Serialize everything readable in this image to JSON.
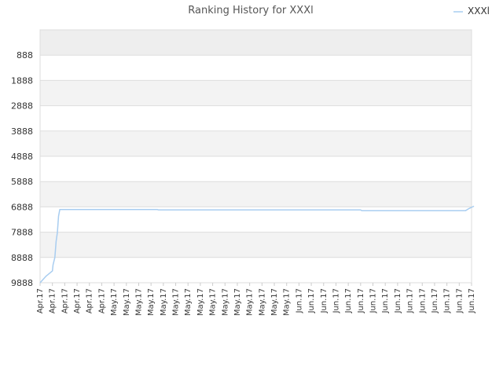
{
  "chart_data": {
    "type": "line",
    "title": "Ranking History for XXXl",
    "xlabel": "",
    "ylabel": "",
    "y_reversed": true,
    "ylim": [
      9888,
      -112
    ],
    "grid": true,
    "grid_style": "alternating horizontal bands",
    "legend_position": "top-right",
    "yticks": [
      888,
      1888,
      2888,
      3888,
      4888,
      5888,
      6888,
      7888,
      8888,
      9888
    ],
    "ytick_labels": [
      "888",
      "1888",
      "2888",
      "3888",
      "4888",
      "5888",
      "6888",
      "7888",
      "8888",
      "9888"
    ],
    "xtick_labels": [
      "Apr.17",
      "Apr.17",
      "Apr.17",
      "Apr.17",
      "Apr.17",
      "Apr.17",
      "May.17",
      "May.17",
      "May.17",
      "May.17",
      "May.17",
      "May.17",
      "May.17",
      "May.17",
      "May.17",
      "May.17",
      "May.17",
      "May.17",
      "May.17",
      "May.17",
      "May.17",
      "Jun.17",
      "Jun.17",
      "Jun.17",
      "Jun.17",
      "Jun.17",
      "Jun.17",
      "Jun.17",
      "Jun.17",
      "Jun.17",
      "Jun.17",
      "Jun.17",
      "Jun.17",
      "Jun.17",
      "Jun.17",
      "Jun.17"
    ],
    "series": [
      {
        "name": "XXXl",
        "color": "#a8cdf0",
        "x": [
          0,
          0.5,
          1,
          1.05,
          1.2,
          1.3,
          1.4,
          1.5,
          1.6,
          9.5,
          9.6,
          26.0,
          26.1,
          34.5,
          34.8,
          35.2
        ],
        "values": [
          9888,
          9620,
          9420,
          9180,
          8888,
          8250,
          7900,
          7250,
          6990,
          6990,
          7010,
          7010,
          7040,
          7040,
          6950,
          6860
        ]
      }
    ]
  }
}
